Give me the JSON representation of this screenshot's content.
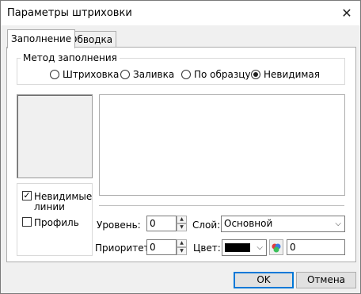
{
  "window": {
    "title": "Параметры штриховки",
    "close_glyph": "✕"
  },
  "tabs": [
    {
      "label": "Заполнение",
      "active": true
    },
    {
      "label": "Обводка",
      "active": false
    }
  ],
  "fill_method": {
    "legend": "Метод заполнения",
    "options": [
      {
        "label": "Штриховка",
        "selected": false
      },
      {
        "label": "Заливка",
        "selected": false
      },
      {
        "label": "По образцу",
        "selected": false
      },
      {
        "label": "Невидимая",
        "selected": true
      }
    ]
  },
  "checks": {
    "hidden_lines": {
      "label_line1": "Невидимые",
      "label_line2": "линии",
      "checked": true
    },
    "profile": {
      "label": "Профиль",
      "checked": false
    }
  },
  "level": {
    "label": "Уровень:",
    "value": "0"
  },
  "priority": {
    "label": "Приоритет:",
    "value": "0"
  },
  "layer": {
    "label": "Слой:",
    "value": "Основной"
  },
  "color": {
    "label": "Цвет:",
    "value": "0",
    "swatch": "#000000"
  },
  "buttons": {
    "ok": "OK",
    "cancel": "Отмена"
  }
}
